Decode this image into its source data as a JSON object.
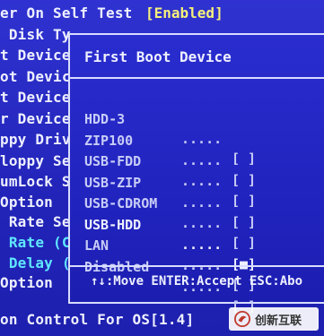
{
  "background_lines": [
    {
      "text": "er On Self Test",
      "color": "white"
    },
    {
      "text": " Disk Ty",
      "color": "white"
    },
    {
      "text": "t Device",
      "color": "white"
    },
    {
      "text": "ot Devic",
      "color": "white"
    },
    {
      "text": "t Device",
      "color": "white"
    },
    {
      "text": "r Device",
      "color": "white"
    },
    {
      "text": "ppy Drive",
      "color": "white"
    },
    {
      "text": "loppy Se",
      "color": "white"
    },
    {
      "text": "umLock S",
      "color": "white"
    },
    {
      "text": "Option",
      "color": "white"
    },
    {
      "text": " Rate Se",
      "color": "white"
    },
    {
      "text": " Rate (C",
      "color": "cyan"
    },
    {
      "text": " Delay (",
      "color": "cyan"
    },
    {
      "text": "Option",
      "color": "white"
    },
    {
      "text": "on Control For OS[1.4]",
      "color": "white"
    }
  ],
  "background_setting": "[Enabled]",
  "popup": {
    "title": "First Boot Device",
    "items": [
      {
        "label": "HDD-3",
        "dots": ".....",
        "box": "[ ]",
        "selected": false
      },
      {
        "label": "ZIP100",
        "dots": ".....",
        "box": "[ ]",
        "selected": false
      },
      {
        "label": "USB-FDD",
        "dots": ".....",
        "box": "[ ]",
        "selected": false
      },
      {
        "label": "USB-ZIP",
        "dots": ".....",
        "box": "[ ]",
        "selected": false
      },
      {
        "label": "USB-CDROM",
        "dots": ".....",
        "box": "[ ]",
        "selected": false
      },
      {
        "label": "USB-HDD",
        "dots": ".....",
        "box": "[■]",
        "selected": true
      },
      {
        "label": "LAN",
        "dots": ".....",
        "box": "[ ]",
        "selected": false
      },
      {
        "label": "Disabled",
        "dots": ".....",
        "box": "[ ]",
        "selected": false
      }
    ],
    "footer": "↑↓:Move ENTER:Accept ESC:Abo"
  },
  "watermark": {
    "text": "创新互联",
    "logo_color": "#c0392b"
  }
}
